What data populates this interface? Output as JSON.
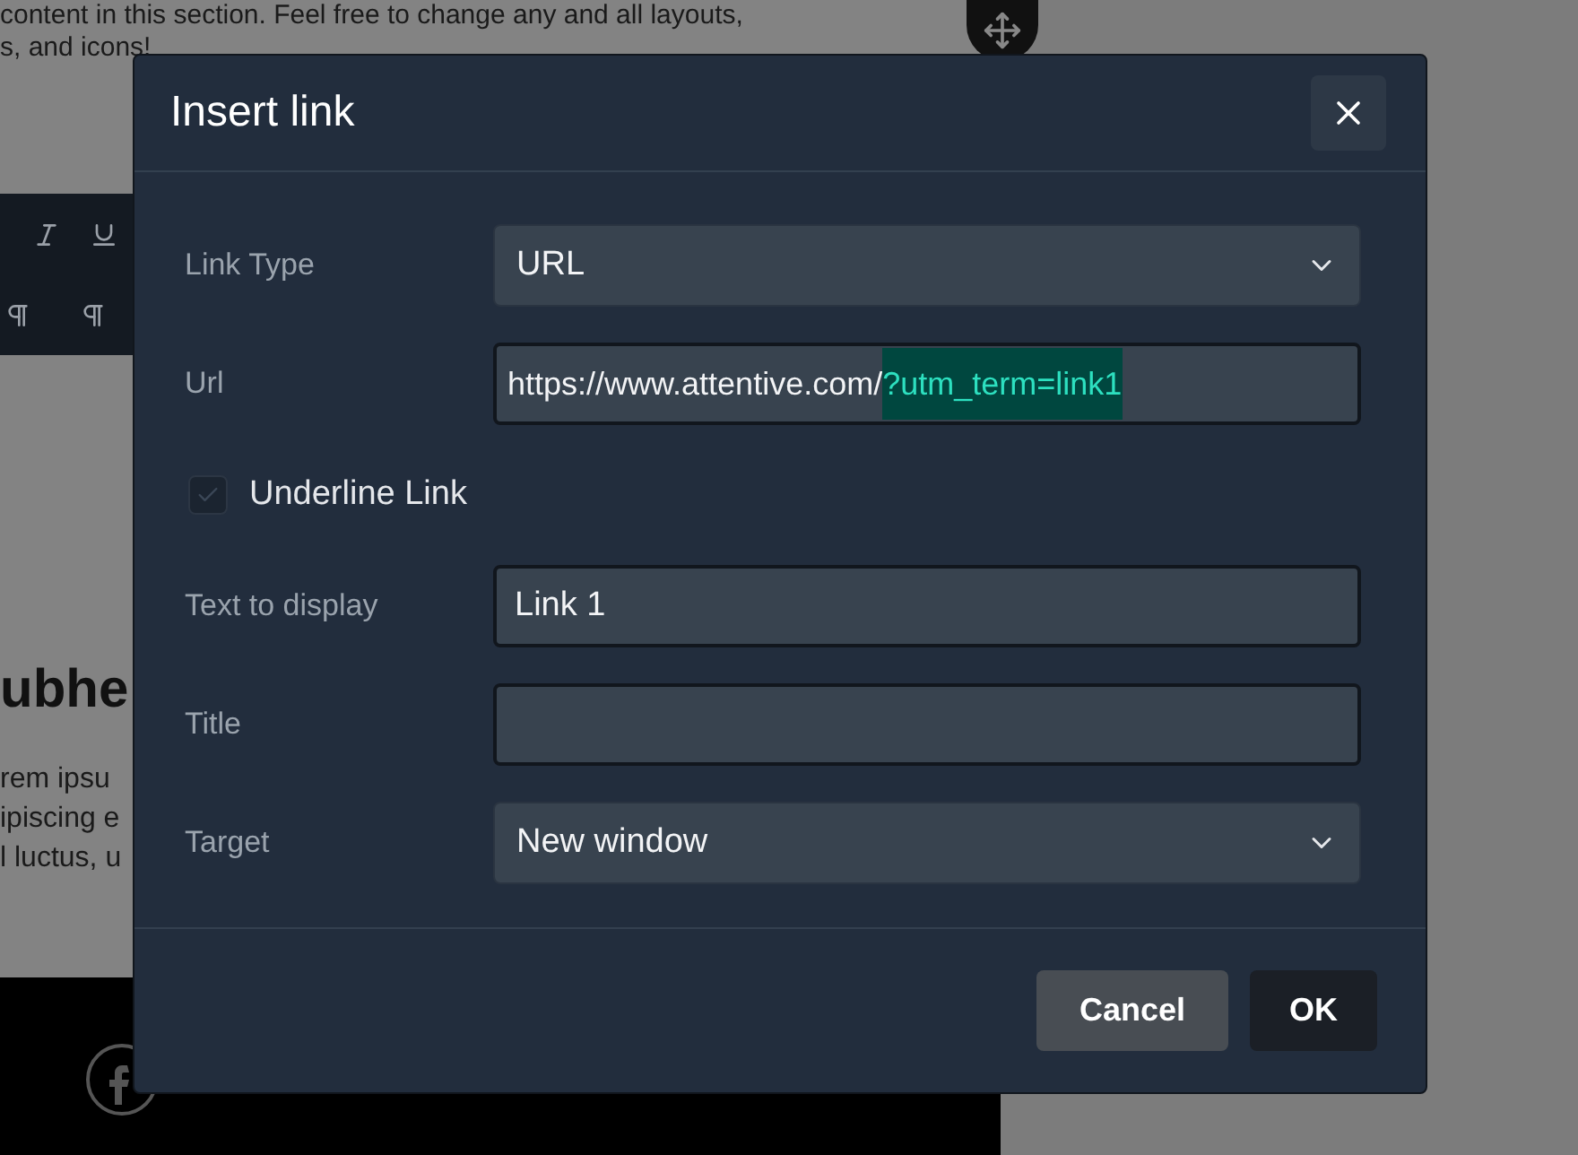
{
  "background": {
    "intro_lines": [
      "content in this section. Feel free to change any and all layouts,",
      "s, and icons!"
    ],
    "subheading": "ubhe",
    "body_lines": [
      "rem ipsu",
      "ipiscing e",
      "l luctus, u"
    ]
  },
  "dialog": {
    "title": "Insert link",
    "fields": [
      {
        "kind": "select",
        "label": "Link Type",
        "value": "URL"
      },
      {
        "kind": "url",
        "label": "Url",
        "value": "https://www.attentive.com/",
        "selected_text": "?utm_term=link1"
      },
      {
        "kind": "checkbox",
        "label": "Underline Link",
        "checked": true
      },
      {
        "kind": "text",
        "label": "Text to display",
        "value": "Link 1"
      },
      {
        "kind": "text",
        "label": "Title"
      },
      {
        "kind": "select",
        "label": "Target",
        "value": "New window"
      }
    ],
    "buttons": [
      {
        "label": "Cancel",
        "kind": "secondary"
      },
      {
        "label": "OK",
        "kind": "primary"
      }
    ]
  }
}
